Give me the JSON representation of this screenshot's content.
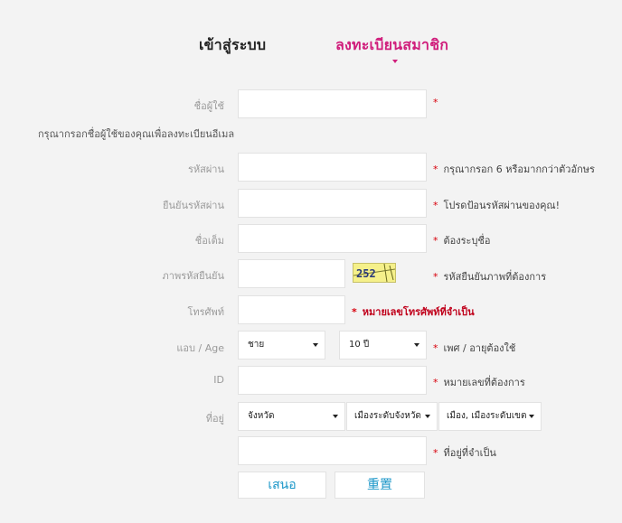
{
  "tabs": {
    "login": "เข้าสู่ระบบ",
    "register": "ลงทะเบียนสมาชิก"
  },
  "form": {
    "username": {
      "label": "ชื่อผู้ใช้",
      "value": "",
      "required_mark": "*",
      "note": "กรุณากรอกชื่อผู้ใช้ของคุณเพื่อลงทะเบียนอีเมล"
    },
    "password": {
      "label": "รหัสผ่าน",
      "value": "",
      "required_mark": "*",
      "hint": "กรุณากรอก 6 หรือมากกว่าตัวอักษร"
    },
    "confirm_password": {
      "label": "ยืนยันรหัสผ่าน",
      "value": "",
      "required_mark": "*",
      "hint": "โปรดป้อนรหัสผ่านของคุณ!"
    },
    "full_name": {
      "label": "ชื่อเต็ม",
      "value": "",
      "required_mark": "*",
      "hint": "ต้องระบุชื่อ"
    },
    "captcha": {
      "label": "ภาพรหัสยืนยัน",
      "value": "",
      "image_text": "252",
      "required_mark": "*",
      "hint": "รหัสยืนยันภาพที่ต้องการ"
    },
    "phone": {
      "label": "โทรศัพท์",
      "value": "",
      "required_mark": "*",
      "hint": "หมายเลขโทรศัพท์ที่จำเป็น"
    },
    "gender_age": {
      "label": "แอบ / Age",
      "gender_selected": "ชาย",
      "age_selected": "10 ปี",
      "required_mark": "*",
      "hint": "เพศ / อายุต้องใช้"
    },
    "id_number": {
      "label": "ID",
      "value": "",
      "required_mark": "*",
      "hint": "หมายเลขที่ต้องการ"
    },
    "address": {
      "label": "ที่อยู่",
      "province_selected": "จังหวัด",
      "district_selected": "เมืองระดับจังหวัด",
      "subdistrict_selected": "เมือง, เมืองระดับเขต",
      "detail_value": "",
      "required_mark": "*",
      "hint": "ที่อยู่ที่จำเป็น"
    }
  },
  "buttons": {
    "submit": "เสนอ",
    "reset": "重置"
  },
  "colors": {
    "accent_pink": "#d01e7c",
    "button_text_blue": "#1a96c8",
    "required_red": "#d8000c",
    "background": "#f3f3f3"
  }
}
